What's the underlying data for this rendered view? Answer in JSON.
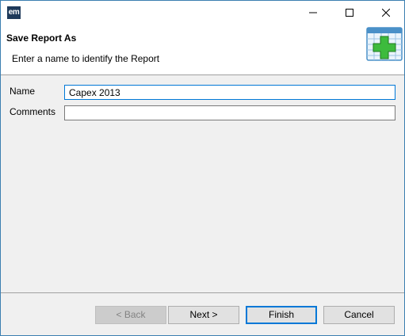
{
  "window": {
    "app_icon_text": "em",
    "minimize_icon": "minimize-icon",
    "maximize_icon": "maximize-icon",
    "close_icon": "close-icon"
  },
  "header": {
    "title": "Save Report As",
    "description": "Enter a name to identify the Report",
    "icon": "new-report-icon"
  },
  "form": {
    "name_label": "Name",
    "name_value": "Capex 2013",
    "comments_label": "Comments",
    "comments_value": ""
  },
  "buttons": {
    "back": "< Back",
    "next": "Next >",
    "finish": "Finish",
    "cancel": "Cancel"
  },
  "colors": {
    "accent": "#0078d7",
    "icon_green": "#3dbb3d"
  }
}
